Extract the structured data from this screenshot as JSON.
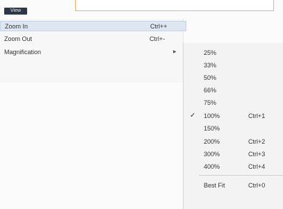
{
  "menu_button": "View",
  "view_menu": {
    "items": [
      {
        "label": "Zoom In",
        "shortcut": "Ctrl++"
      },
      {
        "label": "Zoom Out",
        "shortcut": "Ctrl+-"
      },
      {
        "label": "Magnification",
        "shortcut": ""
      }
    ]
  },
  "magnification_menu": {
    "items": [
      {
        "label": "25%",
        "shortcut": ""
      },
      {
        "label": "33%",
        "shortcut": ""
      },
      {
        "label": "50%",
        "shortcut": ""
      },
      {
        "label": "66%",
        "shortcut": ""
      },
      {
        "label": "75%",
        "shortcut": ""
      },
      {
        "label": "100%",
        "shortcut": "Ctrl+1",
        "checked": true
      },
      {
        "label": "150%",
        "shortcut": ""
      },
      {
        "label": "200%",
        "shortcut": "Ctrl+2"
      },
      {
        "label": "300%",
        "shortcut": "Ctrl+3"
      },
      {
        "label": "400%",
        "shortcut": "Ctrl+4"
      },
      {
        "label": "Best Fit",
        "shortcut": "Ctrl+0"
      }
    ],
    "check_mark": "✓"
  }
}
